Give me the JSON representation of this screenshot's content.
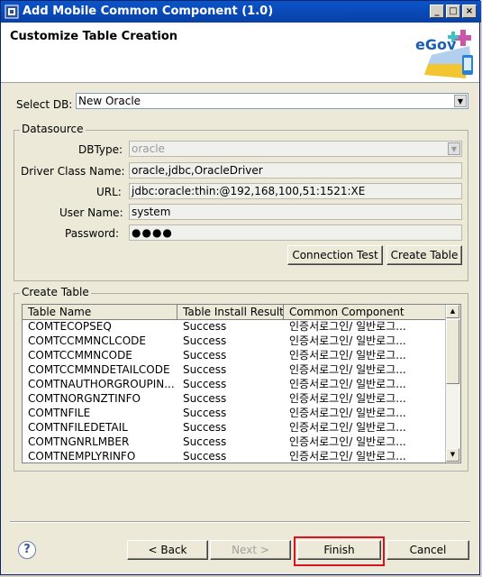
{
  "window": {
    "title": "Add Mobile Common Component (1.0)"
  },
  "header": {
    "title": "Customize Table Creation",
    "logo_text": "eGov"
  },
  "select_db": {
    "label": "Select DB:",
    "value": "New Oracle"
  },
  "datasource": {
    "group_label": "Datasource",
    "dbtype_label": "DBType:",
    "dbtype_value": "oracle",
    "driver_label": "Driver Class Name:",
    "driver_value": "oracle,jdbc,OracleDriver",
    "url_label": "URL:",
    "url_value": "jdbc:oracle:thin:@192,168,100,51:1521:XE",
    "user_label": "User Name:",
    "user_value": "system",
    "password_label": "Password:",
    "password_value": "●●●●",
    "connection_test_label": "Connection Test",
    "create_table_label": "Create Table"
  },
  "create_table": {
    "group_label": "Create Table",
    "columns": [
      "Table Name",
      "Table Install Result",
      "Common Component"
    ],
    "rows": [
      [
        "COMTECOPSEQ",
        "Success",
        "인증서로그인/ 일반로그..."
      ],
      [
        "COMTCCMMNCLCODE",
        "Success",
        "인증서로그인/ 일반로그..."
      ],
      [
        "COMTCCMMNCODE",
        "Success",
        "인증서로그인/ 일반로그..."
      ],
      [
        "COMTCCMMNDETAILCODE",
        "Success",
        "인증서로그인/ 일반로그..."
      ],
      [
        "COMTNAUTHORGROUPIN...",
        "Success",
        "인증서로그인/ 일반로그..."
      ],
      [
        "COMTNORGNZTINFO",
        "Success",
        "인증서로그인/ 일반로그..."
      ],
      [
        "COMTNFILE",
        "Success",
        "인증서로그인/ 일반로그..."
      ],
      [
        "COMTNFILEDETAIL",
        "Success",
        "인증서로그인/ 일반로그..."
      ],
      [
        "COMTNGNRLMBER",
        "Success",
        "인증서로그인/ 일반로그..."
      ],
      [
        "COMTNEMPLYRINFO",
        "Success",
        "인증서로그인/ 일반로그..."
      ]
    ]
  },
  "footer": {
    "help_label": "?",
    "back_label": "< Back",
    "next_label": "Next >",
    "finish_label": "Finish",
    "cancel_label": "Cancel"
  },
  "colors": {
    "title_bar": "#0a54c8",
    "highlight": "#d8121e",
    "dialog_bg": "#ece9d8"
  }
}
